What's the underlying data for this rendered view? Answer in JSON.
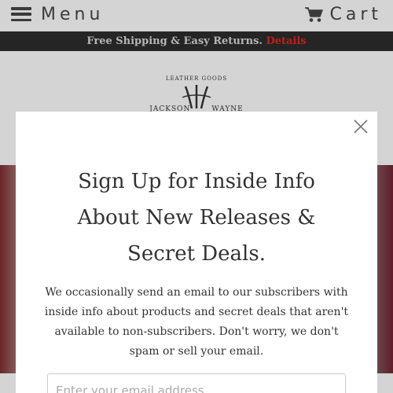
{
  "header": {
    "menu_label": "Menu",
    "menu_icon": "hamburger-icon",
    "cart_label": "Cart",
    "cart_icon": "cart-icon"
  },
  "promo": {
    "text": "Free Shipping & Easy Returns.",
    "link": "Details"
  },
  "logo": {
    "tagline": "LEATHER GOODS",
    "brand_left": "JACKSON",
    "brand_right": "WAYNE"
  },
  "modal": {
    "headline_lines": [
      "Sign Up for Inside Info",
      "About New Releases &",
      "Secret Deals."
    ],
    "body_lines": [
      "We occasionally send an email to our subscribers with",
      "inside info about products and secret deals that aren't",
      "available to non-subscribers. Don't worry, we don't",
      "spam or sell your email."
    ],
    "email_placeholder": "Enter your email address",
    "close_icon": "close-icon"
  },
  "colors": {
    "accent": "#d9261c",
    "promo_bg": "#2b2b2b"
  }
}
